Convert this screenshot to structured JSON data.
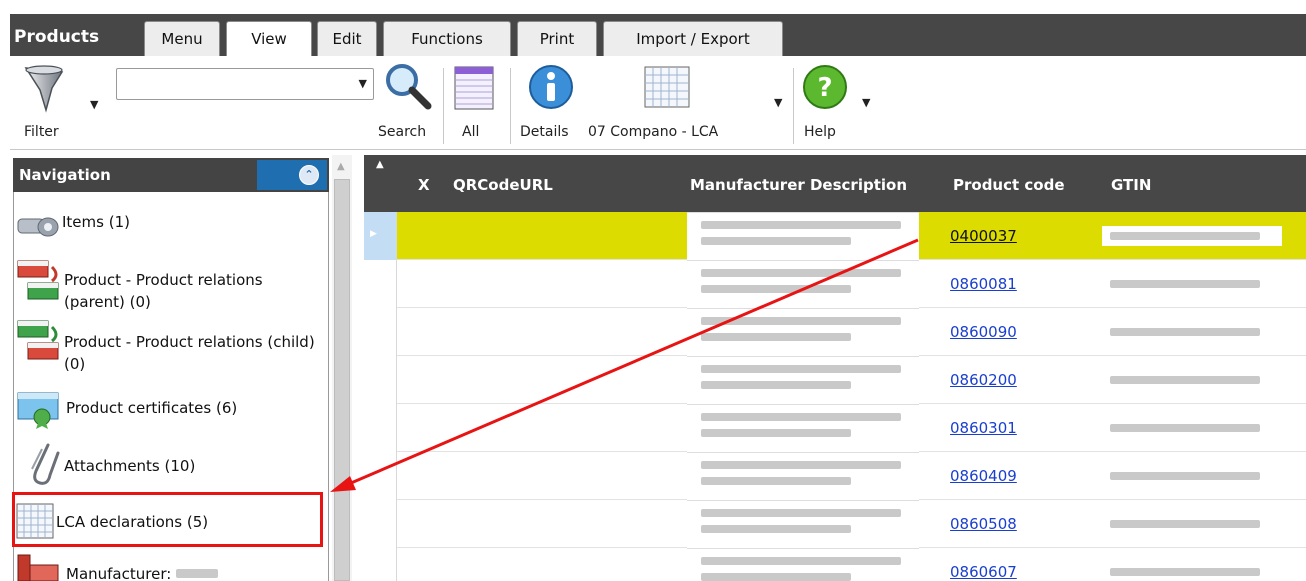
{
  "app": {
    "title": "Products",
    "tabs": [
      {
        "label": "Menu"
      },
      {
        "label": "View"
      },
      {
        "label": "Edit"
      },
      {
        "label": "Functions"
      },
      {
        "label": "Print"
      },
      {
        "label": "Import / Export"
      }
    ],
    "active_tab": "View"
  },
  "ribbon": {
    "filter_label": "Filter",
    "filter_icon": "funnel-icon",
    "search_value": "",
    "search_label": "Search",
    "search_icon": "magnifier-icon",
    "all_label": "All",
    "all_icon": "grid-list-icon",
    "details_label": "Details",
    "details_icon": "info-icon",
    "view_label": "07 Compano - LCA",
    "view_icon": "table-grid-icon",
    "help_label": "Help",
    "help_icon": "help-icon"
  },
  "navigation": {
    "title": "Navigation",
    "items": [
      {
        "label": "Items (1)",
        "icon": "items-icon"
      },
      {
        "label": "Product - Product relations (parent) (0)",
        "icon": "product-relations-icon"
      },
      {
        "label": "Product - Product relations (child) (0)",
        "icon": "product-relations-icon"
      },
      {
        "label": "Product certificates (6)",
        "icon": "certificate-icon"
      },
      {
        "label": "Attachments (10)",
        "icon": "paperclip-icon"
      },
      {
        "label": "LCA declarations (5)",
        "icon": "table-grid-icon"
      },
      {
        "label": "Manufacturer:",
        "icon": "manufacturer-icon"
      }
    ]
  },
  "grid": {
    "columns": [
      "X",
      "QRCodeURL",
      "Manufacturer Description",
      "Product code",
      "GTIN"
    ],
    "rows": [
      {
        "product_code": "0400037",
        "selected": true
      },
      {
        "product_code": "0860081",
        "selected": false
      },
      {
        "product_code": "0860090",
        "selected": false
      },
      {
        "product_code": "0860200",
        "selected": false
      },
      {
        "product_code": "0860301",
        "selected": false
      },
      {
        "product_code": "0860409",
        "selected": false
      },
      {
        "product_code": "0860508",
        "selected": false
      },
      {
        "product_code": "0860607",
        "selected": false
      }
    ]
  },
  "colors": {
    "header": "#474747",
    "selected_row": "#dcdc00",
    "annotation": "#e81414",
    "link": "#1a3fd0"
  }
}
